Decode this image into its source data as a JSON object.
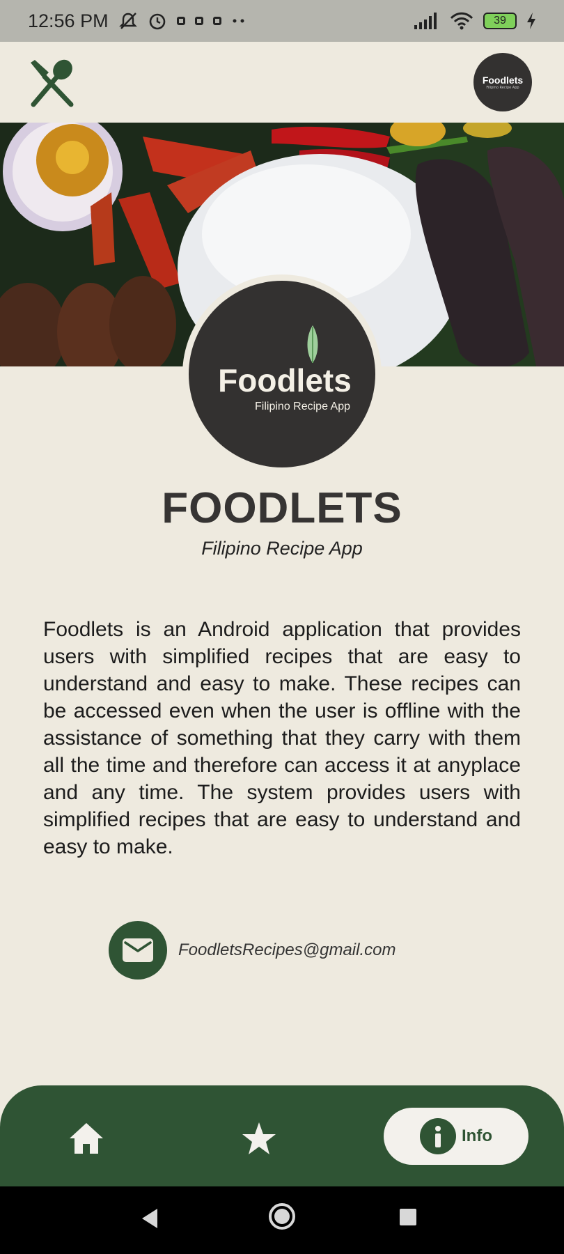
{
  "status_bar": {
    "time": "12:56 PM",
    "battery": "39",
    "icons": [
      "mute-notification-icon",
      "alarm-icon",
      "instagram-icon",
      "app-icon",
      "messenger-icon",
      "more-dots-icon",
      "signal-icon",
      "wifi-icon",
      "battery-icon",
      "charging-icon"
    ]
  },
  "header": {
    "menu_icon": "fork-spoon-icon",
    "logo_text": "Foodlets",
    "logo_subtext": "Filipino Recipe App"
  },
  "hero": {
    "logo_title": "Foodlets",
    "logo_subtitle": "Filipino Recipe App"
  },
  "about": {
    "title": "FOODLETS",
    "subtitle": "Filipino Recipe App",
    "description": "Foodlets is an Android application that provides users with simplified recipes that are easy to understand and easy to make. These recipes can be accessed even when the user is offline with the assistance of something that they carry with them all the time and therefore can access it at anyplace and any time. The system provides users with simplified recipes that are easy to understand and easy to make.",
    "email": "FoodletsRecipes@gmail.com"
  },
  "bottom_nav": {
    "items": [
      {
        "icon": "home-icon"
      },
      {
        "icon": "star-icon"
      },
      {
        "icon": "info-icon",
        "label": "Info",
        "active": true
      }
    ]
  },
  "colors": {
    "brand_green": "#2f5434",
    "background": "#eeeadf",
    "logo_dark": "#333130"
  }
}
